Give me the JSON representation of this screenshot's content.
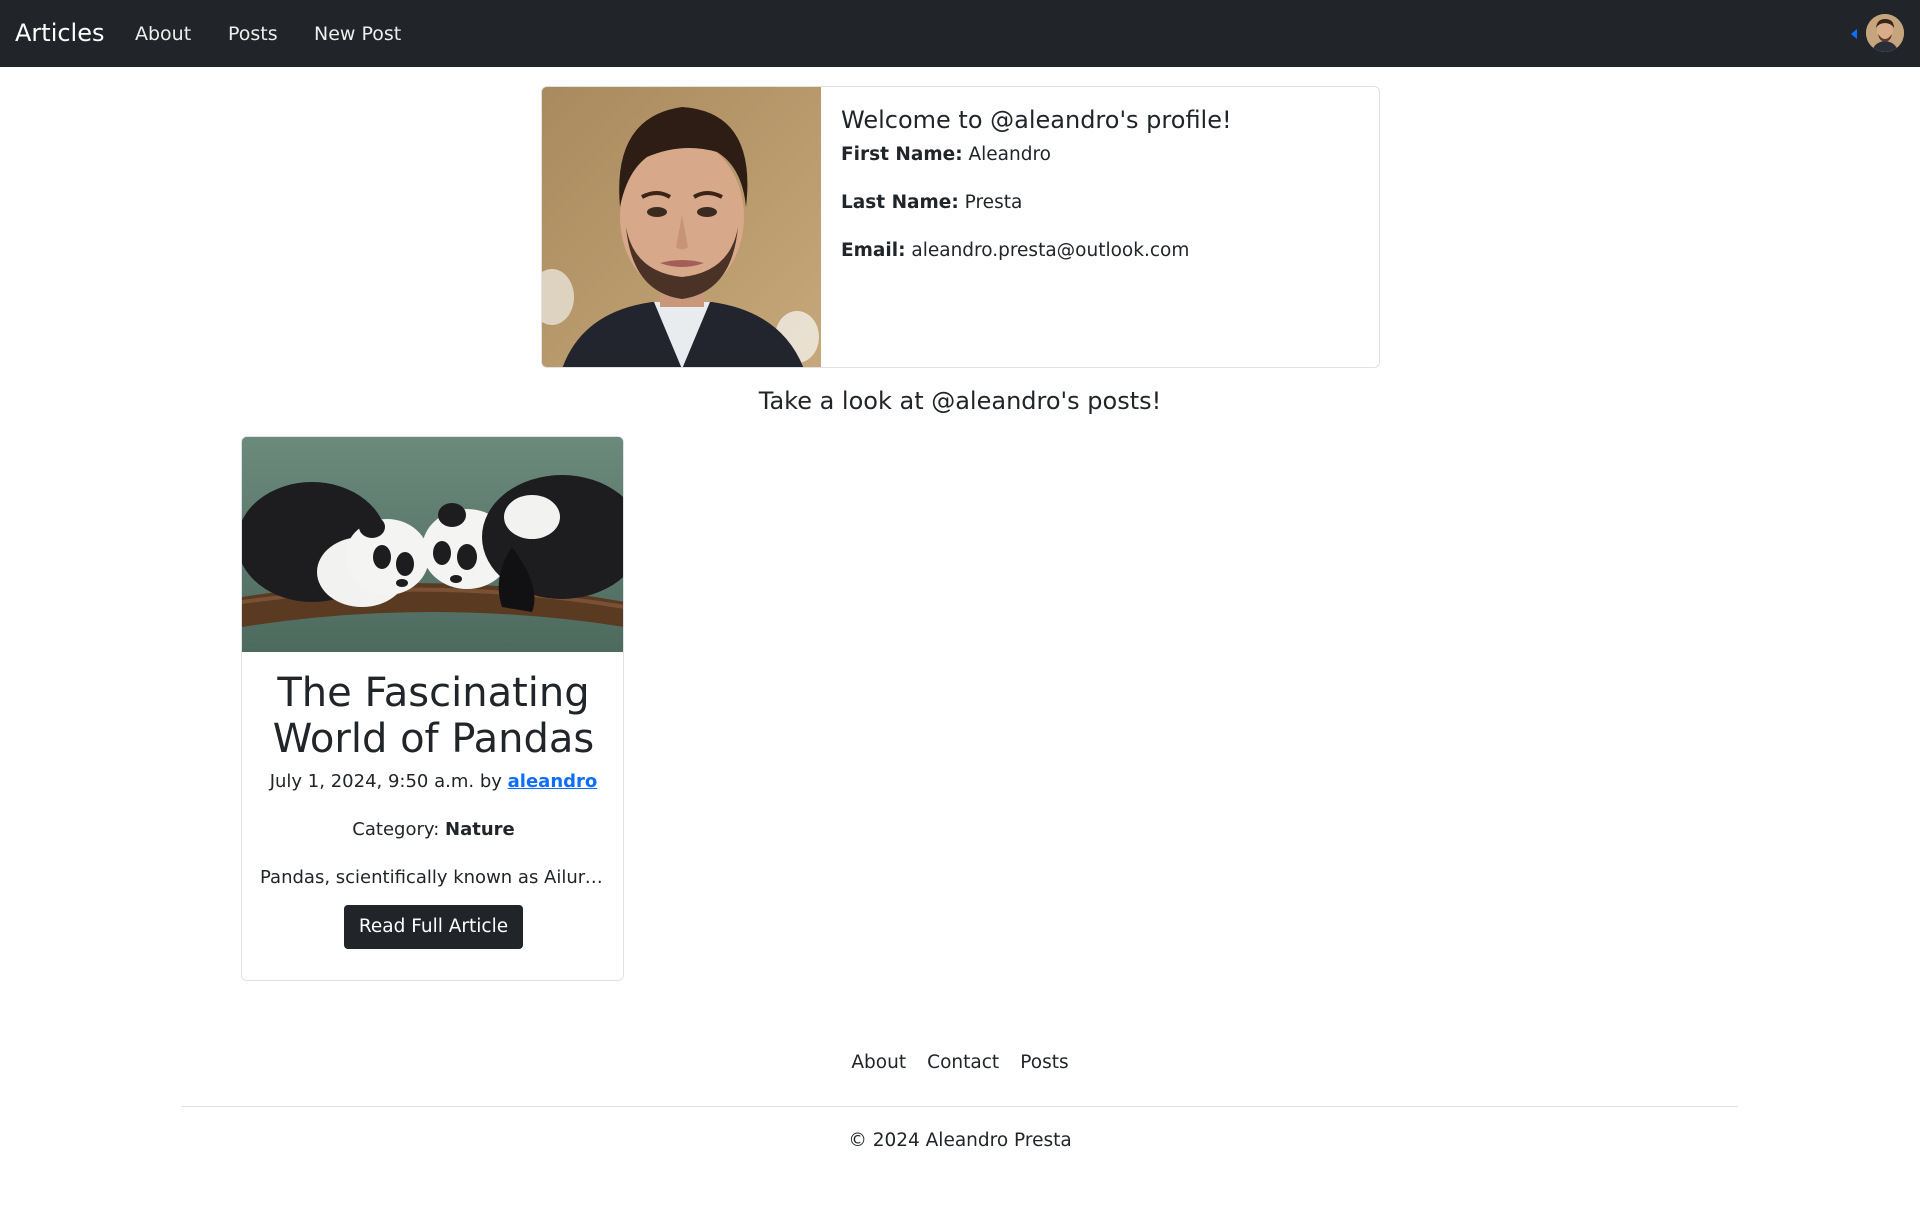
{
  "navbar": {
    "brand": "Articles",
    "links": [
      "About",
      "Posts",
      "New Post"
    ]
  },
  "profile": {
    "title": "Welcome to @aleandro's profile!",
    "first_name_label": "First Name:",
    "first_name": "Aleandro",
    "last_name_label": "Last Name:",
    "last_name": "Presta",
    "email_label": "Email:",
    "email": "aleandro.presta@outlook.com"
  },
  "posts_heading": "Take a look at @aleandro's posts!",
  "posts": [
    {
      "title": "The Fascinating World of Pandas",
      "date": "July 1, 2024, 9:50 a.m.",
      "by": "by",
      "author": "aleandro",
      "category_label": "Category:",
      "category": "Nature",
      "excerpt": "Pandas, scientifically known as Ailuropoda melanoleuca",
      "button": "Read Full Article"
    }
  ],
  "footer": {
    "links": [
      "About",
      "Contact",
      "Posts"
    ],
    "copyright": "© 2024 Aleandro Presta"
  },
  "colors": {
    "navbar_bg": "#212529",
    "link_blue": "#0d6efd",
    "button_bg": "#212529"
  }
}
